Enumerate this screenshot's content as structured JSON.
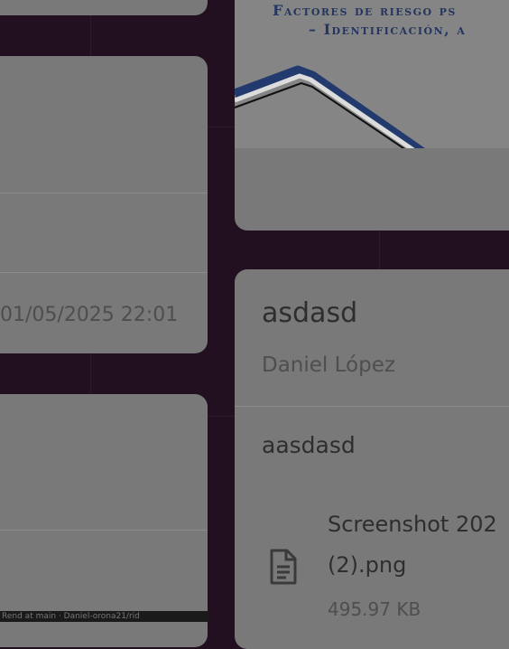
{
  "left_column": {
    "card2": {
      "timestamp": "01/05/2025 22:01"
    },
    "bottom_status": "Rend at main · Daniel-orona21/rid"
  },
  "right_column": {
    "banner_card": {
      "banner_line1": "Factores de riesgo ps",
      "banner_line2": "– Identificación, a"
    },
    "post_card": {
      "title": "asdasd",
      "author": "Daniel López",
      "body": "aasdasd",
      "attachment": {
        "icon": "file-document-icon",
        "name_line1": "Screenshot 202",
        "name_line2": "(2).png",
        "size": "495.97 KB"
      }
    }
  }
}
